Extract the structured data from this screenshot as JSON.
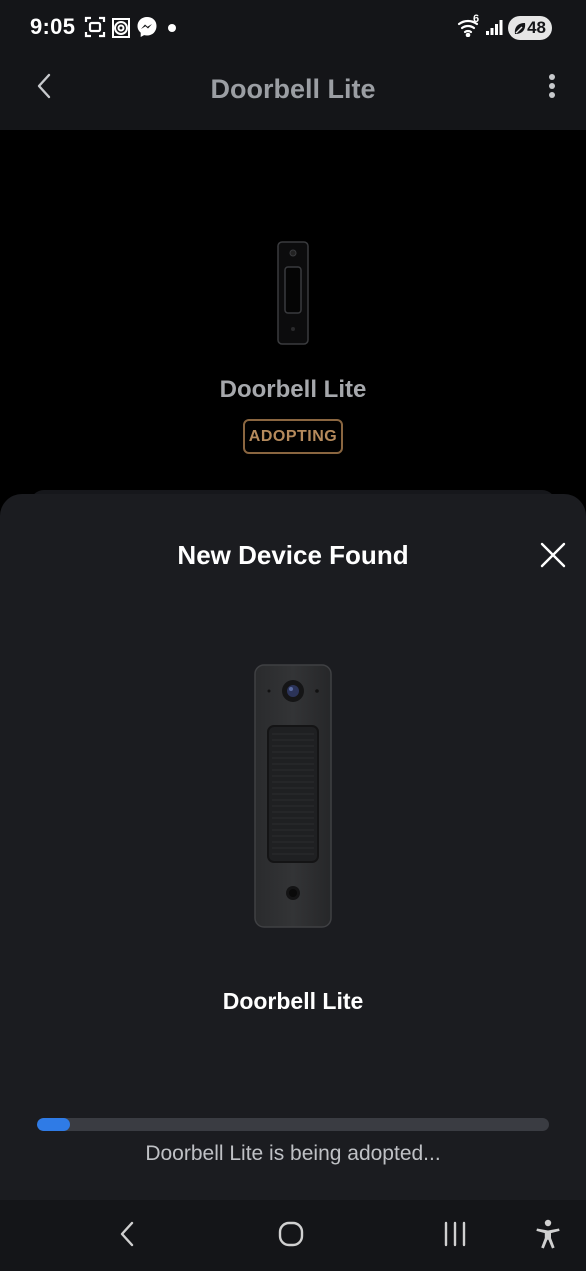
{
  "status_bar": {
    "time": "9:05",
    "battery_level": "48",
    "network_badge": "6",
    "icons": [
      "screenshot-icon",
      "camera-app-icon",
      "messenger-icon",
      "notification-dot-icon",
      "wifi-icon",
      "signal-icon",
      "battery-icon"
    ]
  },
  "app_bar": {
    "title": "Doorbell Lite",
    "back_icon": "chevron-left-icon",
    "more_icon": "more-vertical-icon"
  },
  "device_header": {
    "name": "Doorbell Lite",
    "status_badge": "ADOPTING"
  },
  "sheet": {
    "title": "New Device Found",
    "close_icon": "close-icon",
    "device_name": "Doorbell Lite",
    "progress_fraction": 0.065,
    "progress_text": "Doorbell Lite is being adopted..."
  },
  "nav_bar": {
    "buttons": [
      "back-icon",
      "home-icon",
      "recents-icon",
      "accessibility-icon"
    ]
  },
  "colors": {
    "badge": "#b58a5c",
    "progress": "#2f7be6",
    "sheet_bg": "#1b1c20"
  }
}
